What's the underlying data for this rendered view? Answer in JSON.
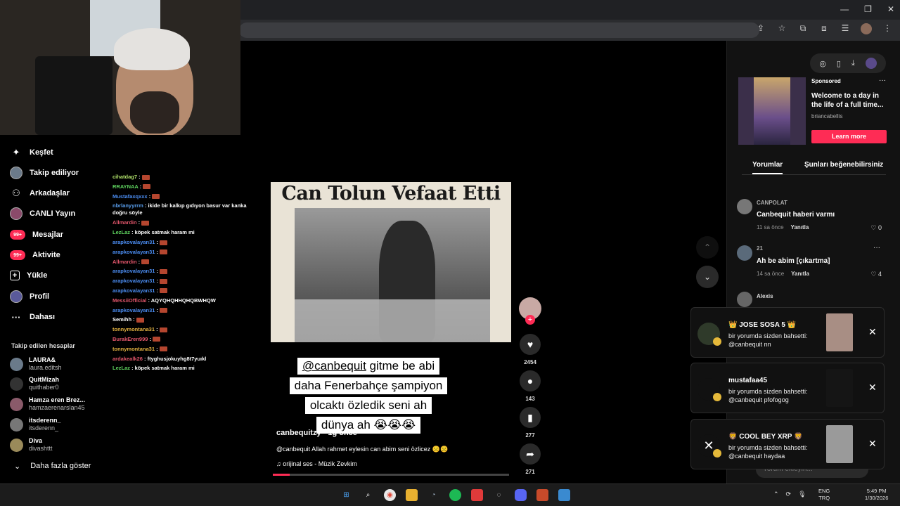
{
  "window": {
    "controls": [
      "—",
      "❐",
      "✕"
    ]
  },
  "browser": {
    "toolbar_icons": [
      "⇪",
      "☆",
      "⧉",
      "⧈",
      "☰"
    ],
    "menu": "⋮"
  },
  "sidebar": {
    "nav": [
      {
        "label": "Keşfet",
        "icon": "compass-icon"
      },
      {
        "label": "Takip ediliyor",
        "icon": "following-avatar-icon"
      },
      {
        "label": "Arkadaşlar",
        "icon": "friends-icon"
      },
      {
        "label": "CANLI Yayın",
        "icon": "live-icon"
      },
      {
        "label": "Mesajlar",
        "icon": "messages-icon",
        "badge": "99+"
      },
      {
        "label": "Aktivite",
        "icon": "activity-icon",
        "badge": "99+"
      },
      {
        "label": "Yükle",
        "icon": "upload-icon"
      },
      {
        "label": "Profil",
        "icon": "profile-icon"
      },
      {
        "label": "Dahası",
        "icon": "more-icon"
      }
    ],
    "followed_title": "Takip edilen hesaplar",
    "followed": [
      {
        "name": "LAURA&",
        "handle": "laura.editsh"
      },
      {
        "name": "QuitMizah",
        "handle": "quithaber0"
      },
      {
        "name": "Hamza eren Brez...",
        "handle": "hamzaerenarslan45"
      },
      {
        "name": "itsderenn_",
        "handle": "itsderenn_"
      },
      {
        "name": "Diva",
        "handle": "divashttt"
      }
    ],
    "show_more": "Daha fazla göster"
  },
  "chat": [
    {
      "user": "cihatdag7",
      "color": "#b0e06a",
      "msg": " :",
      "emote": true
    },
    {
      "user": "RRAYNAA",
      "color": "#5fd35f",
      "msg": " :",
      "emote": true
    },
    {
      "user": "Mustafaxqxxx",
      "color": "#4b8cf0",
      "msg": " :",
      "emote": true
    },
    {
      "user": "nbrlanyyrrm",
      "color": "#5aa0f0",
      "msg": " : ikide bir kalkıp gıdıyon basur var kanka doğru söyle",
      "emote": false,
      "wrap": true
    },
    {
      "user": "Allmardin",
      "color": "#e0556a",
      "msg": " :",
      "emote": true
    },
    {
      "user": "LezLaz",
      "color": "#5fd35f",
      "msg": " : köpek satmak haram mi",
      "emote": false
    },
    {
      "user": "arapkovalayan31",
      "color": "#4b8cf0",
      "msg": " :",
      "emote": true
    },
    {
      "user": "arapkovalayan31",
      "color": "#4b8cf0",
      "msg": " :",
      "emote": true
    },
    {
      "user": "Allmardin",
      "color": "#e0556a",
      "msg": " :",
      "emote": true
    },
    {
      "user": "arapkovalayan31",
      "color": "#4b8cf0",
      "msg": " :",
      "emote": true
    },
    {
      "user": "arapkovalayan31",
      "color": "#4b8cf0",
      "msg": " :",
      "emote": true
    },
    {
      "user": "arapkovalayan31",
      "color": "#4b8cf0",
      "msg": " :",
      "emote": true
    },
    {
      "user": "MessiiOfficial",
      "color": "#e0556a",
      "msg": " : AQYQHQHHQHQBWHQW",
      "emote": false
    },
    {
      "user": "arapkovalayan31",
      "color": "#4b8cf0",
      "msg": " :",
      "emote": true
    },
    {
      "user": "Semihh",
      "color": "#ffffff",
      "msg": " :",
      "emote": true
    },
    {
      "user": "tonnymontana31",
      "color": "#e0b040",
      "msg": " :",
      "emote": true
    },
    {
      "user": "BurakEren999",
      "color": "#e0556a",
      "msg": " :",
      "emote": true
    },
    {
      "user": "tonnymontana31",
      "color": "#e0b040",
      "msg": " :",
      "emote": true
    },
    {
      "user": "ardakealk26",
      "color": "#e0556a",
      "msg": " : ftyghusjokuyhg8t7yuıkl",
      "emote": false
    },
    {
      "user": "LezLaz",
      "color": "#5fd35f",
      "msg": " : köpek satmak haram mi",
      "emote": false
    }
  ],
  "video": {
    "headline": "Can Tolun Vefaat Etti",
    "caption_lines": [
      {
        "mention": "@canbequit",
        "text": " gitme be abi"
      },
      {
        "mention": "",
        "text": "daha Fenerbahçe şampiyon"
      },
      {
        "mention": "",
        "text": "olcaktı özledik seni ah"
      },
      {
        "mention": "",
        "text": "dünya ah 😭😭😭"
      }
    ],
    "author": "canbequitzy · 1g önce",
    "description": "@canbequit  Allah rahmet eylesin can abim seni özlicez ☹️☹️",
    "sound": "♫  orijinal ses - Müzik Zevkim",
    "progress": 0.07
  },
  "actions": {
    "likes": "2454",
    "comments": "143",
    "saves": "277",
    "shares": "271"
  },
  "ad": {
    "label": "Sponsored",
    "title": "Welcome to a day in the life of a full time...",
    "user": "briancabellis",
    "cta": "Learn more"
  },
  "tabs": [
    "Yorumlar",
    "Şunları beğenebilirsiniz"
  ],
  "comments": [
    {
      "user": "CANPOLAT",
      "text": "Canbequit haberi varmı",
      "time": "11 sa önce",
      "reply": "Yanıtla",
      "likes": "0"
    },
    {
      "user": "21",
      "text": "Ah be abim [çıkartma]",
      "time": "14 sa önce",
      "reply": "Yanıtla",
      "likes": "4"
    },
    {
      "user": "Alexis",
      "text": "",
      "time": "",
      "reply": "",
      "likes": ""
    }
  ],
  "comment_input": "Yorum ekleyin...",
  "notifications": [
    {
      "title": "👑 JOSE SOSA 5 👑",
      "body": "bir yorumda sizden bahsetti: @canbequit nn"
    },
    {
      "title": "mustafaa45",
      "body": "bir yorumda sizden bahsetti: @canbequit pfofogog"
    },
    {
      "title": "🦁 COOL BEY XRP 🦁",
      "body": "bir yorumda sizden bahsetti: @canbequit haydaa"
    }
  ],
  "taskbar": {
    "lang": [
      "ENG",
      "TRQ"
    ],
    "time": "5:49 PM",
    "date": "1/30/2026"
  }
}
